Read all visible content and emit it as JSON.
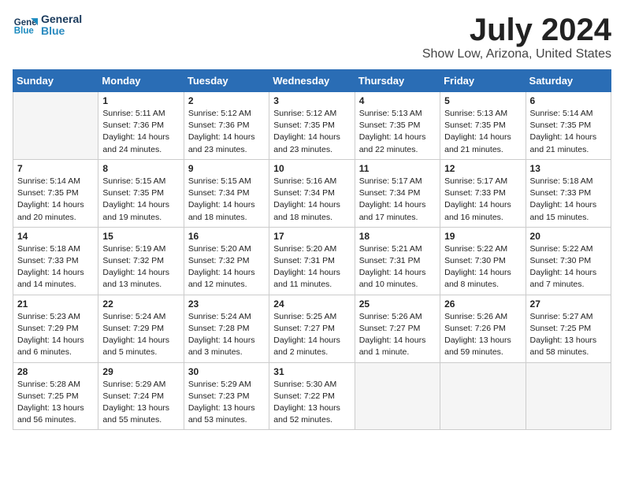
{
  "header": {
    "logo_line1": "General",
    "logo_line2": "Blue",
    "month_title": "July 2024",
    "location": "Show Low, Arizona, United States"
  },
  "days_of_week": [
    "Sunday",
    "Monday",
    "Tuesday",
    "Wednesday",
    "Thursday",
    "Friday",
    "Saturday"
  ],
  "weeks": [
    {
      "shaded": false,
      "days": [
        {
          "num": "",
          "data": ""
        },
        {
          "num": "1",
          "data": "Sunrise: 5:11 AM\nSunset: 7:36 PM\nDaylight: 14 hours\nand 24 minutes."
        },
        {
          "num": "2",
          "data": "Sunrise: 5:12 AM\nSunset: 7:36 PM\nDaylight: 14 hours\nand 23 minutes."
        },
        {
          "num": "3",
          "data": "Sunrise: 5:12 AM\nSunset: 7:35 PM\nDaylight: 14 hours\nand 23 minutes."
        },
        {
          "num": "4",
          "data": "Sunrise: 5:13 AM\nSunset: 7:35 PM\nDaylight: 14 hours\nand 22 minutes."
        },
        {
          "num": "5",
          "data": "Sunrise: 5:13 AM\nSunset: 7:35 PM\nDaylight: 14 hours\nand 21 minutes."
        },
        {
          "num": "6",
          "data": "Sunrise: 5:14 AM\nSunset: 7:35 PM\nDaylight: 14 hours\nand 21 minutes."
        }
      ]
    },
    {
      "shaded": true,
      "days": [
        {
          "num": "7",
          "data": "Sunrise: 5:14 AM\nSunset: 7:35 PM\nDaylight: 14 hours\nand 20 minutes."
        },
        {
          "num": "8",
          "data": "Sunrise: 5:15 AM\nSunset: 7:35 PM\nDaylight: 14 hours\nand 19 minutes."
        },
        {
          "num": "9",
          "data": "Sunrise: 5:15 AM\nSunset: 7:34 PM\nDaylight: 14 hours\nand 18 minutes."
        },
        {
          "num": "10",
          "data": "Sunrise: 5:16 AM\nSunset: 7:34 PM\nDaylight: 14 hours\nand 18 minutes."
        },
        {
          "num": "11",
          "data": "Sunrise: 5:17 AM\nSunset: 7:34 PM\nDaylight: 14 hours\nand 17 minutes."
        },
        {
          "num": "12",
          "data": "Sunrise: 5:17 AM\nSunset: 7:33 PM\nDaylight: 14 hours\nand 16 minutes."
        },
        {
          "num": "13",
          "data": "Sunrise: 5:18 AM\nSunset: 7:33 PM\nDaylight: 14 hours\nand 15 minutes."
        }
      ]
    },
    {
      "shaded": false,
      "days": [
        {
          "num": "14",
          "data": "Sunrise: 5:18 AM\nSunset: 7:33 PM\nDaylight: 14 hours\nand 14 minutes."
        },
        {
          "num": "15",
          "data": "Sunrise: 5:19 AM\nSunset: 7:32 PM\nDaylight: 14 hours\nand 13 minutes."
        },
        {
          "num": "16",
          "data": "Sunrise: 5:20 AM\nSunset: 7:32 PM\nDaylight: 14 hours\nand 12 minutes."
        },
        {
          "num": "17",
          "data": "Sunrise: 5:20 AM\nSunset: 7:31 PM\nDaylight: 14 hours\nand 11 minutes."
        },
        {
          "num": "18",
          "data": "Sunrise: 5:21 AM\nSunset: 7:31 PM\nDaylight: 14 hours\nand 10 minutes."
        },
        {
          "num": "19",
          "data": "Sunrise: 5:22 AM\nSunset: 7:30 PM\nDaylight: 14 hours\nand 8 minutes."
        },
        {
          "num": "20",
          "data": "Sunrise: 5:22 AM\nSunset: 7:30 PM\nDaylight: 14 hours\nand 7 minutes."
        }
      ]
    },
    {
      "shaded": true,
      "days": [
        {
          "num": "21",
          "data": "Sunrise: 5:23 AM\nSunset: 7:29 PM\nDaylight: 14 hours\nand 6 minutes."
        },
        {
          "num": "22",
          "data": "Sunrise: 5:24 AM\nSunset: 7:29 PM\nDaylight: 14 hours\nand 5 minutes."
        },
        {
          "num": "23",
          "data": "Sunrise: 5:24 AM\nSunset: 7:28 PM\nDaylight: 14 hours\nand 3 minutes."
        },
        {
          "num": "24",
          "data": "Sunrise: 5:25 AM\nSunset: 7:27 PM\nDaylight: 14 hours\nand 2 minutes."
        },
        {
          "num": "25",
          "data": "Sunrise: 5:26 AM\nSunset: 7:27 PM\nDaylight: 14 hours\nand 1 minute."
        },
        {
          "num": "26",
          "data": "Sunrise: 5:26 AM\nSunset: 7:26 PM\nDaylight: 13 hours\nand 59 minutes."
        },
        {
          "num": "27",
          "data": "Sunrise: 5:27 AM\nSunset: 7:25 PM\nDaylight: 13 hours\nand 58 minutes."
        }
      ]
    },
    {
      "shaded": false,
      "days": [
        {
          "num": "28",
          "data": "Sunrise: 5:28 AM\nSunset: 7:25 PM\nDaylight: 13 hours\nand 56 minutes."
        },
        {
          "num": "29",
          "data": "Sunrise: 5:29 AM\nSunset: 7:24 PM\nDaylight: 13 hours\nand 55 minutes."
        },
        {
          "num": "30",
          "data": "Sunrise: 5:29 AM\nSunset: 7:23 PM\nDaylight: 13 hours\nand 53 minutes."
        },
        {
          "num": "31",
          "data": "Sunrise: 5:30 AM\nSunset: 7:22 PM\nDaylight: 13 hours\nand 52 minutes."
        },
        {
          "num": "",
          "data": ""
        },
        {
          "num": "",
          "data": ""
        },
        {
          "num": "",
          "data": ""
        }
      ]
    }
  ]
}
